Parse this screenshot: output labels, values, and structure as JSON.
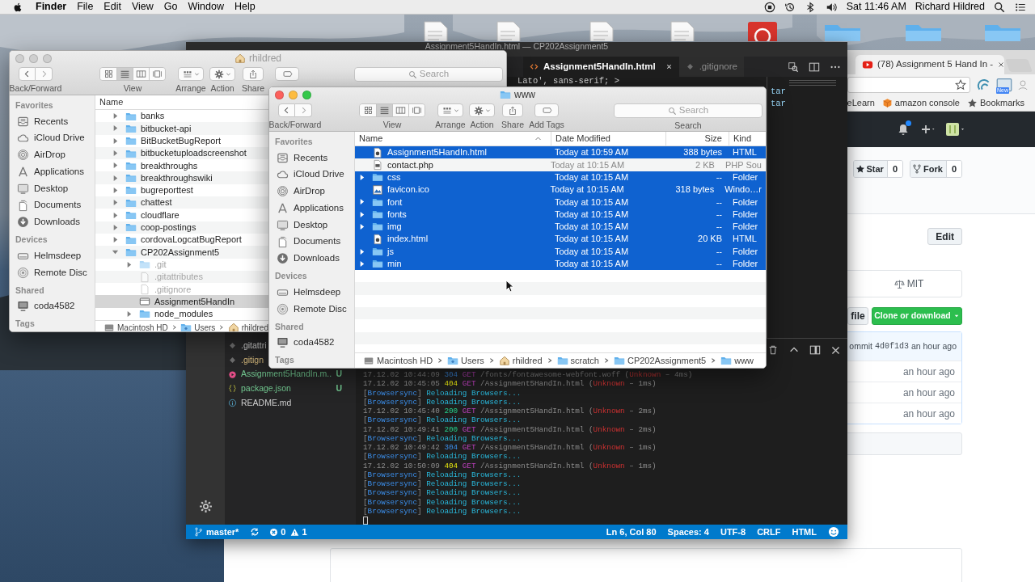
{
  "menu_bar": {
    "app": "Finder",
    "menus": [
      "File",
      "Edit",
      "View",
      "Go",
      "Window",
      "Help"
    ],
    "clock": "Sat 11:46 AM",
    "user": "Richard Hildred"
  },
  "browser": {
    "tabs": [
      {
        "label": "(78) Assignment 5 Hand In - ",
        "selected": true
      }
    ],
    "extension_badge": "New",
    "bookmarks": [
      {
        "label": "eLearn",
        "kind": "site"
      },
      {
        "label": "amazon console",
        "kind": "box"
      },
      {
        "label": "Bookmarks",
        "kind": "star"
      }
    ],
    "repo": {
      "star_label": "Star",
      "star_count": "0",
      "fork_label": "Fork",
      "fork_count": "0",
      "edit_button": "Edit",
      "license": "MIT",
      "file_button": "file",
      "clone_button": "Clone or download",
      "commit_prefix": "ommit",
      "commit_sha": "4d0f1d3",
      "commit_age": "an hour ago",
      "file_ages": [
        "an hour ago",
        "an hour ago",
        "an hour ago"
      ]
    }
  },
  "editor": {
    "title": "Assignment5HandIn.html — CP202Assignment5",
    "tabs": [
      {
        "label": "Assignment5HandIn.html",
        "selected": true,
        "kind": "html"
      },
      {
        "label": ".gitignore",
        "selected": false,
        "kind": "git"
      }
    ],
    "code_lines": [
      "Lato', sans-serif; >"
    ],
    "side_code_lines": [
      "tar",
      "tar"
    ],
    "explorer": [
      {
        "name": ".gitattri",
        "kind": "git",
        "ignored": false
      },
      {
        "name": ".gitign",
        "kind": "git",
        "ignored": true
      },
      {
        "name": "Assignment5HandIn.m..",
        "kind": "html",
        "ignored": false,
        "status": "U"
      },
      {
        "name": "package.json",
        "kind": "json",
        "ignored": false,
        "status": "U"
      },
      {
        "name": "README.md",
        "kind": "info",
        "ignored": false
      }
    ]
  },
  "terminal": {
    "lines": [
      {
        "dimmed": true,
        "parts": [
          {
            "text": "17.12.02 10:44:09 ",
            "kind": "time"
          },
          {
            "text": "304",
            "kind": "status_redirect"
          },
          {
            "text": " GET",
            "kind": "method"
          },
          {
            "text": " /fonts/fontawesome-webfont.woff (",
            "kind": "path"
          },
          {
            "text": "Unknown",
            "kind": "error"
          },
          {
            "text": " – 4ms)",
            "kind": "path"
          }
        ]
      },
      {
        "dimmed": false,
        "parts": [
          {
            "text": "17.12.02 10:45:05 ",
            "kind": "time"
          },
          {
            "text": "404",
            "kind": "status_missing"
          },
          {
            "text": " GET",
            "kind": "method"
          },
          {
            "text": " /Assignment5HandIn.html (",
            "kind": "path"
          },
          {
            "text": "Unknown",
            "kind": "error"
          },
          {
            "text": " – 1ms)",
            "kind": "path"
          }
        ]
      },
      {
        "dimmed": false,
        "parts": [
          {
            "text": "[",
            "kind": "bracket"
          },
          {
            "text": "Browsersync",
            "kind": "tag"
          },
          {
            "text": "]",
            "kind": "bracket"
          },
          {
            "text": " Reloading Browsers...",
            "kind": "message"
          }
        ]
      },
      {
        "dimmed": false,
        "parts": [
          {
            "text": "[",
            "kind": "bracket"
          },
          {
            "text": "Browsersync",
            "kind": "tag"
          },
          {
            "text": "]",
            "kind": "bracket"
          },
          {
            "text": " Reloading Browsers...",
            "kind": "message"
          }
        ]
      },
      {
        "dimmed": false,
        "parts": [
          {
            "text": "17.12.02 10:45:40 ",
            "kind": "time"
          },
          {
            "text": "200",
            "kind": "status_ok"
          },
          {
            "text": " GET",
            "kind": "method"
          },
          {
            "text": " /Assignment5HandIn.html (",
            "kind": "path"
          },
          {
            "text": "Unknown",
            "kind": "error"
          },
          {
            "text": " – 2ms)",
            "kind": "path"
          }
        ]
      },
      {
        "dimmed": false,
        "parts": [
          {
            "text": "[",
            "kind": "bracket"
          },
          {
            "text": "Browsersync",
            "kind": "tag"
          },
          {
            "text": "]",
            "kind": "bracket"
          },
          {
            "text": " Reloading Browsers...",
            "kind": "message"
          }
        ]
      },
      {
        "dimmed": false,
        "parts": [
          {
            "text": "17.12.02 10:49:41 ",
            "kind": "time"
          },
          {
            "text": "200",
            "kind": "status_ok"
          },
          {
            "text": " GET",
            "kind": "method"
          },
          {
            "text": " /Assignment5HandIn.html (",
            "kind": "path"
          },
          {
            "text": "Unknown",
            "kind": "error"
          },
          {
            "text": " – 2ms)",
            "kind": "path"
          }
        ]
      },
      {
        "dimmed": false,
        "parts": [
          {
            "text": "[",
            "kind": "bracket"
          },
          {
            "text": "Browsersync",
            "kind": "tag"
          },
          {
            "text": "]",
            "kind": "bracket"
          },
          {
            "text": " Reloading Browsers...",
            "kind": "message"
          }
        ]
      },
      {
        "dimmed": false,
        "parts": [
          {
            "text": "17.12.02 10:49:42 ",
            "kind": "time"
          },
          {
            "text": "304",
            "kind": "status_redirect"
          },
          {
            "text": " GET",
            "kind": "method"
          },
          {
            "text": " /Assignment5HandIn.html (",
            "kind": "path"
          },
          {
            "text": "Unknown",
            "kind": "error"
          },
          {
            "text": " – 1ms)",
            "kind": "path"
          }
        ]
      },
      {
        "dimmed": false,
        "parts": [
          {
            "text": "[",
            "kind": "bracket"
          },
          {
            "text": "Browsersync",
            "kind": "tag"
          },
          {
            "text": "]",
            "kind": "bracket"
          },
          {
            "text": " Reloading Browsers...",
            "kind": "message"
          }
        ]
      },
      {
        "dimmed": false,
        "parts": [
          {
            "text": "17.12.02 10:50:09 ",
            "kind": "time"
          },
          {
            "text": "404",
            "kind": "status_missing"
          },
          {
            "text": " GET",
            "kind": "method"
          },
          {
            "text": " /Assignment5HandIn.html (",
            "kind": "path"
          },
          {
            "text": "Unknown",
            "kind": "error"
          },
          {
            "text": " – 1ms)",
            "kind": "path"
          }
        ]
      },
      {
        "dimmed": false,
        "parts": [
          {
            "text": "[",
            "kind": "bracket"
          },
          {
            "text": "Browsersync",
            "kind": "tag"
          },
          {
            "text": "]",
            "kind": "bracket"
          },
          {
            "text": " Reloading Browsers...",
            "kind": "message"
          }
        ]
      },
      {
        "dimmed": false,
        "parts": [
          {
            "text": "[",
            "kind": "bracket"
          },
          {
            "text": "Browsersync",
            "kind": "tag"
          },
          {
            "text": "]",
            "kind": "bracket"
          },
          {
            "text": " Reloading Browsers...",
            "kind": "message"
          }
        ]
      },
      {
        "dimmed": false,
        "parts": [
          {
            "text": "[",
            "kind": "bracket"
          },
          {
            "text": "Browsersync",
            "kind": "tag"
          },
          {
            "text": "]",
            "kind": "bracket"
          },
          {
            "text": " Reloading Browsers...",
            "kind": "message"
          }
        ]
      },
      {
        "dimmed": false,
        "parts": [
          {
            "text": "[",
            "kind": "bracket"
          },
          {
            "text": "Browsersync",
            "kind": "tag"
          },
          {
            "text": "]",
            "kind": "bracket"
          },
          {
            "text": " Reloading Browsers...",
            "kind": "message"
          }
        ]
      },
      {
        "dimmed": false,
        "parts": [
          {
            "text": "[",
            "kind": "bracket"
          },
          {
            "text": "Browsersync",
            "kind": "tag"
          },
          {
            "text": "]",
            "kind": "bracket"
          },
          {
            "text": " Reloading Browsers...",
            "kind": "message"
          }
        ]
      }
    ],
    "cursor": true
  },
  "status_bar": {
    "branch": "master*",
    "errors": "0",
    "warnings": "1",
    "items": [
      "Ln 6, Col 80",
      "Spaces: 4",
      "UTF-8",
      "CRLF",
      "HTML"
    ]
  },
  "finders": [
    {
      "title": "rhildred",
      "title_icon": {
        "kind": "home"
      },
      "active": false,
      "toolbar": [
        {
          "kind": "nav",
          "label": "Back/Forward"
        },
        {
          "kind": "view",
          "label": "View"
        },
        {
          "kind": "arrange",
          "label": "Arrange"
        },
        {
          "kind": "action",
          "label": "Action"
        },
        {
          "kind": "share",
          "label": "Share"
        },
        {
          "kind": "tags"
        },
        {
          "kind": "search",
          "placeholder": "Search"
        }
      ],
      "view_modes": [
        {
          "selected": false
        },
        {
          "selected": true
        },
        {
          "selected": false
        },
        {
          "selected": false
        }
      ],
      "sidebar": [
        {
          "heading": "Favorites",
          "items": [
            {
              "label": "Recents",
              "kind": "recents"
            },
            {
              "label": "iCloud Drive",
              "kind": "cloud"
            },
            {
              "label": "AirDrop",
              "kind": "airdrop"
            },
            {
              "label": "Applications",
              "kind": "apps"
            },
            {
              "label": "Desktop",
              "kind": "desktop"
            },
            {
              "label": "Documents",
              "kind": "documents"
            },
            {
              "label": "Downloads",
              "kind": "downloads"
            }
          ]
        },
        {
          "heading": "Devices",
          "items": [
            {
              "label": "Helmsdeep",
              "kind": "drive"
            },
            {
              "label": "Remote Disc",
              "kind": "disc"
            }
          ]
        },
        {
          "heading": "Shared",
          "items": [
            {
              "label": "coda4582",
              "kind": "computer"
            }
          ]
        },
        {
          "heading": "Tags"
        }
      ],
      "columns": [
        {
          "label": "Name",
          "sorted": false
        }
      ],
      "rows": [
        {
          "name": "banks",
          "kind": "folder",
          "expanded": false,
          "selected": false,
          "dimmed": false
        },
        {
          "name": "bitbucket-api",
          "kind": "folder",
          "expanded": false,
          "selected": false,
          "dimmed": false
        },
        {
          "name": "BitBucketBugReport",
          "kind": "folder",
          "expanded": false,
          "selected": false,
          "dimmed": false
        },
        {
          "name": "bitbucketuploadscreenshot",
          "kind": "folder",
          "expanded": false,
          "selected": false,
          "dimmed": false
        },
        {
          "name": "breakthroughs",
          "kind": "folder",
          "expanded": false,
          "selected": false,
          "dimmed": false
        },
        {
          "name": "breakthroughswiki",
          "kind": "folder",
          "expanded": false,
          "selected": false,
          "dimmed": false
        },
        {
          "name": "bugreporttest",
          "kind": "folder",
          "expanded": false,
          "selected": false,
          "dimmed": false
        },
        {
          "name": "chattest",
          "kind": "folder",
          "expanded": false,
          "selected": false,
          "dimmed": false
        },
        {
          "name": "cloudflare",
          "kind": "folder",
          "expanded": false,
          "selected": false,
          "dimmed": false
        },
        {
          "name": "coop-postings",
          "kind": "folder",
          "expanded": false,
          "selected": false,
          "dimmed": false
        },
        {
          "name": "cordovaLogcatBugReport",
          "kind": "folder",
          "expanded": false,
          "selected": false,
          "dimmed": false
        },
        {
          "name": "CP202Assignment5",
          "kind": "folder",
          "expanded": true,
          "selected": false,
          "dimmed": false,
          "children": [
            {
              "name": ".git",
              "kind": "folder",
              "expanded": false,
              "selected": false,
              "dimmed": true
            },
            {
              "name": ".gitattributes",
              "kind": "doc",
              "selected": false,
              "dimmed": true
            },
            {
              "name": ".gitignore",
              "kind": "doc",
              "selected": false,
              "dimmed": true
            },
            {
              "name": "Assignment5HandIn",
              "kind": "app",
              "selected": true,
              "dimmed": false
            },
            {
              "name": "node_modules",
              "kind": "folder",
              "expanded": false,
              "selected": false,
              "dimmed": false
            }
          ]
        }
      ],
      "path": [
        {
          "label": "Macintosh HD",
          "kind": "disk"
        },
        {
          "label": "Users",
          "kind": "users"
        },
        {
          "label": "rhildred",
          "kind": "home"
        }
      ]
    },
    {
      "title": "www",
      "title_icon": {
        "kind": "folder"
      },
      "active": true,
      "toolbar": [
        {
          "kind": "nav",
          "label": "Back/Forward"
        },
        {
          "kind": "view",
          "label": "View"
        },
        {
          "kind": "arrange",
          "label": "Arrange"
        },
        {
          "kind": "action",
          "label": "Action"
        },
        {
          "kind": "share",
          "label": "Share"
        },
        {
          "kind": "tags",
          "label": "Add Tags"
        },
        {
          "kind": "search",
          "label": "Search",
          "placeholder": "Search"
        }
      ],
      "view_modes": [
        {
          "selected": false
        },
        {
          "selected": true
        },
        {
          "selected": false
        },
        {
          "selected": false
        }
      ],
      "sidebar": [
        {
          "heading": "Favorites",
          "items": [
            {
              "label": "Recents",
              "kind": "recents"
            },
            {
              "label": "iCloud Drive",
              "kind": "cloud"
            },
            {
              "label": "AirDrop",
              "kind": "airdrop"
            },
            {
              "label": "Applications",
              "kind": "apps"
            },
            {
              "label": "Desktop",
              "kind": "desktop"
            },
            {
              "label": "Documents",
              "kind": "documents"
            },
            {
              "label": "Downloads",
              "kind": "downloads"
            }
          ]
        },
        {
          "heading": "Devices",
          "items": [
            {
              "label": "Helmsdeep",
              "kind": "drive"
            },
            {
              "label": "Remote Disc",
              "kind": "disc"
            }
          ]
        },
        {
          "heading": "Shared",
          "items": [
            {
              "label": "coda4582",
              "kind": "computer"
            }
          ]
        },
        {
          "heading": "Tags"
        }
      ],
      "columns": [
        {
          "label": "Name",
          "sorted": true
        },
        {
          "label": "Date Modified",
          "sorted": false
        },
        {
          "label": "Size",
          "sorted": false
        },
        {
          "label": "Kind",
          "sorted": false
        }
      ],
      "rows": [
        {
          "name": "Assignment5HandIn.html",
          "kind": "html",
          "selected": true,
          "dimmed": false,
          "date": "Today at 10:59 AM",
          "size": "388 bytes",
          "type": "HTML"
        },
        {
          "name": "contact.php",
          "kind": "php",
          "selected": false,
          "dimmed": false,
          "date": "Today at 10:15 AM",
          "size": "2 KB",
          "type": "PHP Sou"
        },
        {
          "name": "css",
          "kind": "folder",
          "expanded": false,
          "selected": true,
          "dimmed": false,
          "date": "Today at 10:15 AM",
          "size": "--",
          "type": "Folder"
        },
        {
          "name": "favicon.ico",
          "kind": "ico",
          "selected": true,
          "dimmed": false,
          "date": "Today at 10:15 AM",
          "size": "318 bytes",
          "type": "Windo…r"
        },
        {
          "name": "font",
          "kind": "folder",
          "expanded": false,
          "selected": true,
          "dimmed": false,
          "date": "Today at 10:15 AM",
          "size": "--",
          "type": "Folder"
        },
        {
          "name": "fonts",
          "kind": "folder",
          "expanded": false,
          "selected": true,
          "dimmed": false,
          "date": "Today at 10:15 AM",
          "size": "--",
          "type": "Folder"
        },
        {
          "name": "img",
          "kind": "folder",
          "expanded": false,
          "selected": true,
          "dimmed": false,
          "date": "Today at 10:15 AM",
          "size": "--",
          "type": "Folder"
        },
        {
          "name": "index.html",
          "kind": "html",
          "selected": true,
          "dimmed": false,
          "date": "Today at 10:15 AM",
          "size": "20 KB",
          "type": "HTML"
        },
        {
          "name": "js",
          "kind": "folder",
          "expanded": false,
          "selected": true,
          "dimmed": false,
          "date": "Today at 10:15 AM",
          "size": "--",
          "type": "Folder"
        },
        {
          "name": "min",
          "kind": "folder",
          "expanded": false,
          "selected": true,
          "dimmed": false,
          "date": "Today at 10:15 AM",
          "size": "--",
          "type": "Folder"
        }
      ],
      "path": [
        {
          "label": "Macintosh HD",
          "kind": "disk"
        },
        {
          "label": "Users",
          "kind": "users"
        },
        {
          "label": "rhildred",
          "kind": "home"
        },
        {
          "label": "scratch",
          "kind": "folder"
        },
        {
          "label": "CP202Assignment5",
          "kind": "folder"
        },
        {
          "label": "www",
          "kind": "folder"
        }
      ]
    }
  ]
}
